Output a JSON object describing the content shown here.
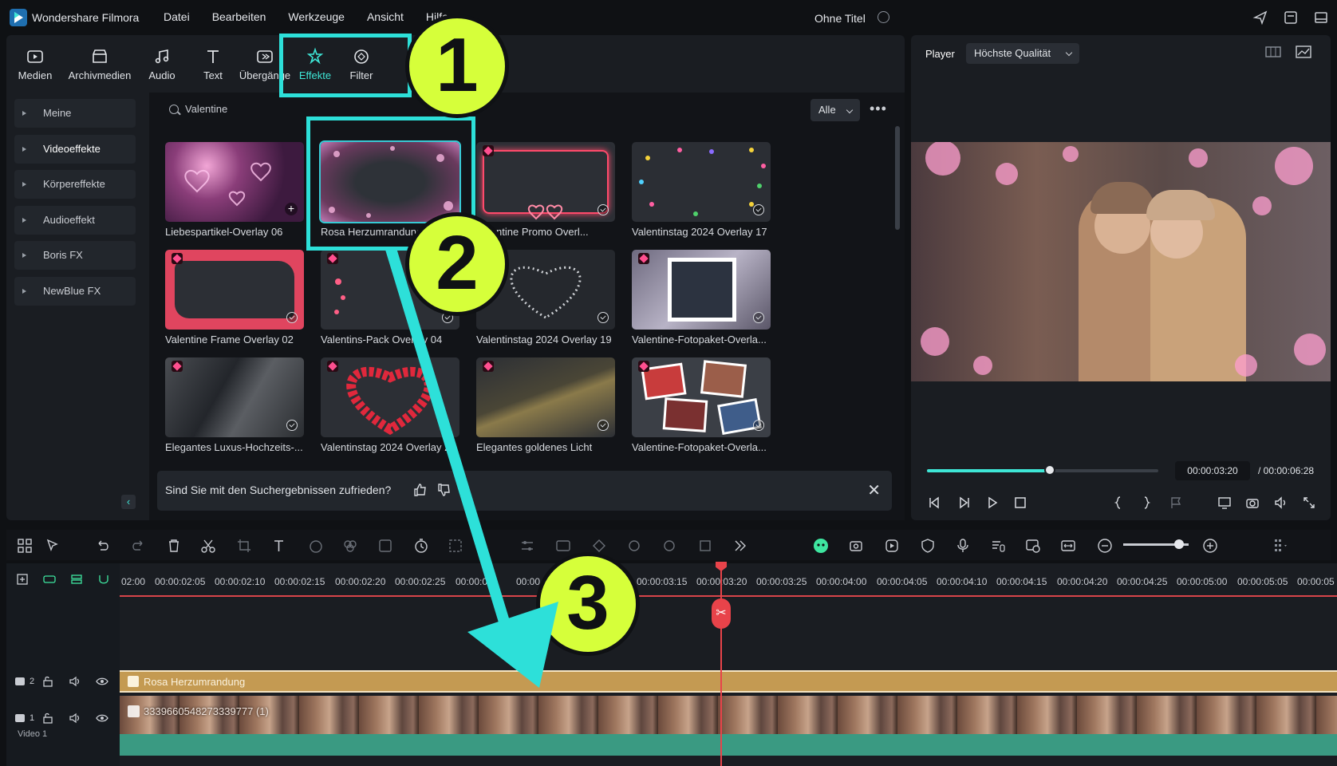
{
  "app": {
    "name": "Wondershare Filmora",
    "menu": [
      "Datei",
      "Bearbeiten",
      "Werkzeuge",
      "Ansicht",
      "Hilfe"
    ],
    "doc_title": "Ohne Titel"
  },
  "toolbar": {
    "items": [
      {
        "label": "Medien",
        "icon": "media-icon"
      },
      {
        "label": "Archivmedien",
        "icon": "stock-icon"
      },
      {
        "label": "Audio",
        "icon": "music-note-icon"
      },
      {
        "label": "Text",
        "icon": "text-icon"
      },
      {
        "label": "Übergänge",
        "icon": "transition-icon"
      },
      {
        "label": "Effekte",
        "icon": "effects-icon"
      },
      {
        "label": "Filter",
        "icon": "filter-icon"
      }
    ],
    "active": "Effekte",
    "accent": "#3ee6d6"
  },
  "sidebar": {
    "items": [
      "Meine",
      "Videoeffekte",
      "Körpereffekte",
      "Audioeffekt",
      "Boris FX",
      "NewBlue FX"
    ]
  },
  "search": {
    "value": "Valentine",
    "filter": "Alle"
  },
  "effects": [
    {
      "label": "Liebespartikel-Overlay 06",
      "premium": false,
      "action": "add"
    },
    {
      "label": "Rosa Herzumrandung",
      "premium": false,
      "action": "selected"
    },
    {
      "label": "Valentine Promo Overl...",
      "premium": true,
      "action": "download"
    },
    {
      "label": "Valentinstag 2024 Overlay 17",
      "premium": false,
      "action": "download"
    },
    {
      "label": "Valentine Frame Overlay 02",
      "premium": true,
      "action": "download"
    },
    {
      "label": "Valentins-Pack Overlay 04",
      "premium": true,
      "action": "download"
    },
    {
      "label": "Valentinstag 2024 Overlay 19",
      "premium": false,
      "action": "download"
    },
    {
      "label": "Valentine-Fotopaket-Overla...",
      "premium": true,
      "action": "download"
    },
    {
      "label": "Elegantes Luxus-Hochzeits-...",
      "premium": true,
      "action": "download"
    },
    {
      "label": "Valentinstag 2024 Overlay 2",
      "premium": true,
      "action": "download"
    },
    {
      "label": "Elegantes goldenes Licht",
      "premium": true,
      "action": "download"
    },
    {
      "label": "Valentine-Fotopaket-Overla...",
      "premium": true,
      "action": "download"
    }
  ],
  "feedback": {
    "question": "Sind Sie mit den Suchergebnissen zufrieden?"
  },
  "player": {
    "label": "Player",
    "quality": "Höchste Qualität",
    "current_time": "00:00:03:20",
    "total_time": "/ 00:00:06:28",
    "progress": 0.53
  },
  "timeline": {
    "ruler": [
      "02:00",
      "00:00:02:05",
      "00:00:02:10",
      "00:00:02:15",
      "00:00:02:20",
      "00:00:02:25",
      "00:00:03",
      "00:00",
      "00:00:03:15",
      "00:00:03:20",
      "00:00:03:25",
      "00:00:04:00",
      "00:00:04:05",
      "00:00:04:10",
      "00:00:04:15",
      "00:00:04:20",
      "00:00:04:25",
      "00:00:05:00",
      "00:00:05:05",
      "00:00:05"
    ],
    "effect_clip": "Rosa Herzumrandung",
    "video_clip": "3339660548273339777 (1)",
    "track_effect_num": "2",
    "track_video_num": "1",
    "video_track_name": "Video 1",
    "zoom": 0.85
  },
  "annotations": {
    "badges": [
      "1",
      "2",
      "3"
    ],
    "color": "#2de0d9",
    "badge_color": "#d6ff3a"
  }
}
